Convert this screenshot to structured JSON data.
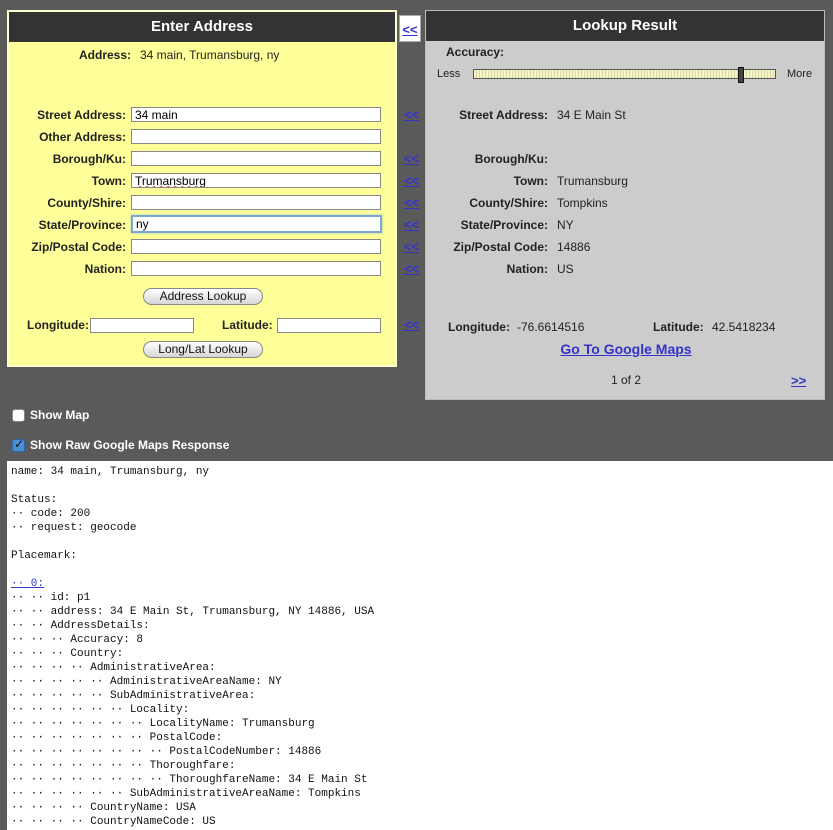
{
  "enter_address": {
    "title": "Enter Address",
    "address_label": "Address:",
    "address_value": "34 main, Trumansburg, ny",
    "fields": [
      {
        "label": "Street Address:",
        "value": "34 main"
      },
      {
        "label": "Other Address:",
        "value": ""
      },
      {
        "label": "Borough/Ku:",
        "value": ""
      },
      {
        "label": "Town:",
        "value": "Trumansburg"
      },
      {
        "label": "County/Shire:",
        "value": ""
      },
      {
        "label": "State/Province:",
        "value": "ny"
      },
      {
        "label": "Zip/Postal Code:",
        "value": ""
      },
      {
        "label": "Nation:",
        "value": ""
      }
    ],
    "address_lookup_button": "Address Lookup",
    "longitude_label": "Longitude:",
    "longitude_value": "",
    "latitude_label": "Latitude:",
    "latitude_value": "",
    "longlat_lookup_button": "Long/Lat Lookup"
  },
  "copy_arrow": "<<",
  "lookup_result": {
    "title": "Lookup Result",
    "accuracy_label": "Accuracy:",
    "less_label": "Less",
    "more_label": "More",
    "accuracy_level": 0.89,
    "fields": [
      {
        "label": "Street Address:",
        "value": "34 E Main St"
      },
      {
        "label": "Borough/Ku:",
        "value": ""
      },
      {
        "label": "Town:",
        "value": "Trumansburg"
      },
      {
        "label": "County/Shire:",
        "value": "Tompkins"
      },
      {
        "label": "State/Province:",
        "value": "NY"
      },
      {
        "label": "Zip/Postal Code:",
        "value": "14886"
      },
      {
        "label": "Nation:",
        "value": "US"
      }
    ],
    "longitude_label": "Longitude:",
    "longitude_value": "-76.6614516",
    "latitude_label": "Latitude:",
    "latitude_value": "42.5418234",
    "google_maps_link": "Go To Google Maps",
    "pagination": "1 of 2",
    "next_arrow": ">>"
  },
  "options": {
    "show_map_label": "Show Map",
    "show_map_checked": false,
    "show_raw_label": "Show Raw Google Maps Response",
    "show_raw_checked": true
  },
  "raw_response": [
    "name: 34 main, Trumansburg, ny",
    "",
    "Status:",
    "·· code: 200",
    "·· request: geocode",
    "",
    "Placemark:",
    "",
    "·· 0:",
    "·· ·· id: p1",
    "·· ·· address: 34 E Main St, Trumansburg, NY 14886, USA",
    "·· ·· AddressDetails:",
    "·· ·· ·· Accuracy: 8",
    "·· ·· ·· Country:",
    "·· ·· ·· ·· AdministrativeArea:",
    "·· ·· ·· ·· ·· AdministrativeAreaName: NY",
    "·· ·· ·· ·· ·· SubAdministrativeArea:",
    "·· ·· ·· ·· ·· ·· Locality:",
    "·· ·· ·· ·· ·· ·· ·· LocalityName: Trumansburg",
    "·· ·· ·· ·· ·· ·· ·· PostalCode:",
    "·· ·· ·· ·· ·· ·· ·· ·· PostalCodeNumber: 14886",
    "·· ·· ·· ·· ·· ·· ·· Thoroughfare:",
    "·· ·· ·· ·· ·· ·· ·· ·· ThoroughfareName: 34 E Main St",
    "·· ·· ·· ·· ·· ·· SubAdministrativeAreaName: Tompkins",
    "·· ·· ·· ·· CountryName: USA",
    "·· ·· ·· ·· CountryNameCode: US"
  ]
}
